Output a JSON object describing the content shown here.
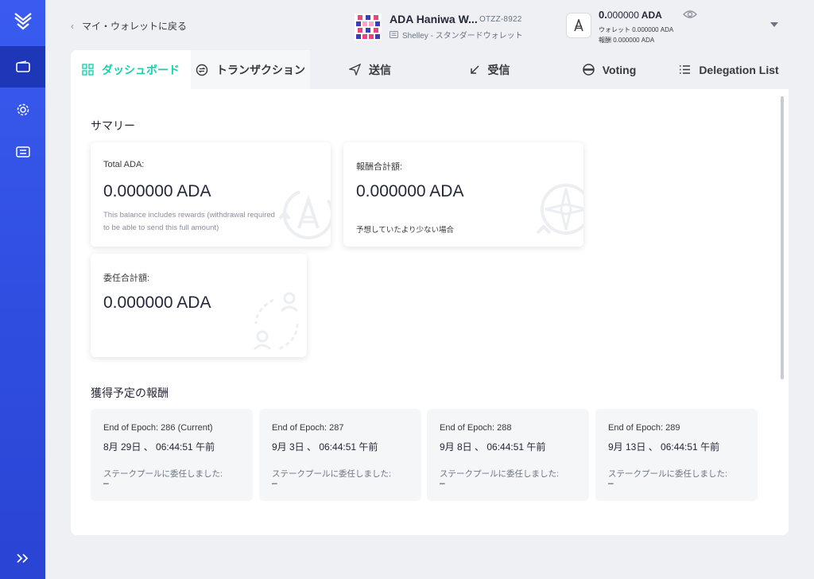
{
  "sidebar": {
    "items": [
      {
        "name": "wallet-icon",
        "active": true
      },
      {
        "name": "gear-icon",
        "active": false
      },
      {
        "name": "paperwallet-icon",
        "active": false
      }
    ],
    "expand_icon": "double-chevron-right-icon"
  },
  "topbar": {
    "back_label": "マイ・ウォレットに戻る",
    "wallet_name": "ADA Haniwa W...",
    "wallet_plate": "OTZZ-8922",
    "wallet_type": "Shelley - スタンダードウォレット",
    "balance_int": "0.",
    "balance_dec": "000000",
    "balance_unit": " ADA",
    "wallet_balance": "ウォレット 0.000000 ADA",
    "reward_balance": "報酬 0.000000 ADA"
  },
  "tabs": [
    {
      "label": "ダッシュボード",
      "icon": "dashboard-icon"
    },
    {
      "label": "トランザクション",
      "icon": "transactions-icon"
    },
    {
      "label": "送信",
      "icon": "send-icon"
    },
    {
      "label": "受信",
      "icon": "receive-icon"
    },
    {
      "label": "Voting",
      "icon": "voting-icon"
    },
    {
      "label": "Delegation List",
      "icon": "list-icon"
    }
  ],
  "summary": {
    "title": "サマリー",
    "total": {
      "label": "Total ADA:",
      "value_int": "0.",
      "value_rest": "000000 ADA",
      "note": "This balance includes rewards (withdrawal required to be able to send this full amount)"
    },
    "rewards": {
      "label": "報酬合計額:",
      "value_int": "0.",
      "value_rest": "000000 ADA",
      "note": "予想していたより少ない場合"
    },
    "delegated": {
      "label": "委任合計額:",
      "value_int": "0.",
      "value_rest": "000000 ADA"
    }
  },
  "upcoming": {
    "title": "獲得予定の報酬",
    "epochs": [
      {
        "epoch": "End of Epoch:  286 (Current)",
        "date": "8月 29日 、 06:44:51 午前",
        "pool_label": "ステークプールに委任しました:",
        "pool": "–"
      },
      {
        "epoch": "End of Epoch:  287",
        "date": "9月 3日 、 06:44:51 午前",
        "pool_label": "ステークプールに委任しました:",
        "pool": "–"
      },
      {
        "epoch": "End of Epoch:  288",
        "date": "9月 8日 、 06:44:51 午前",
        "pool_label": "ステークプールに委任しました:",
        "pool": "–"
      },
      {
        "epoch": "End of Epoch:  289",
        "date": "9月 13日 、 06:44:51 午前",
        "pool_label": "ステークプールに委任しました:",
        "pool": "–"
      }
    ]
  },
  "colors": {
    "accent": "#17d1aa",
    "sidebar": "#3154e8",
    "sidebar_active": "#1e37b8"
  }
}
